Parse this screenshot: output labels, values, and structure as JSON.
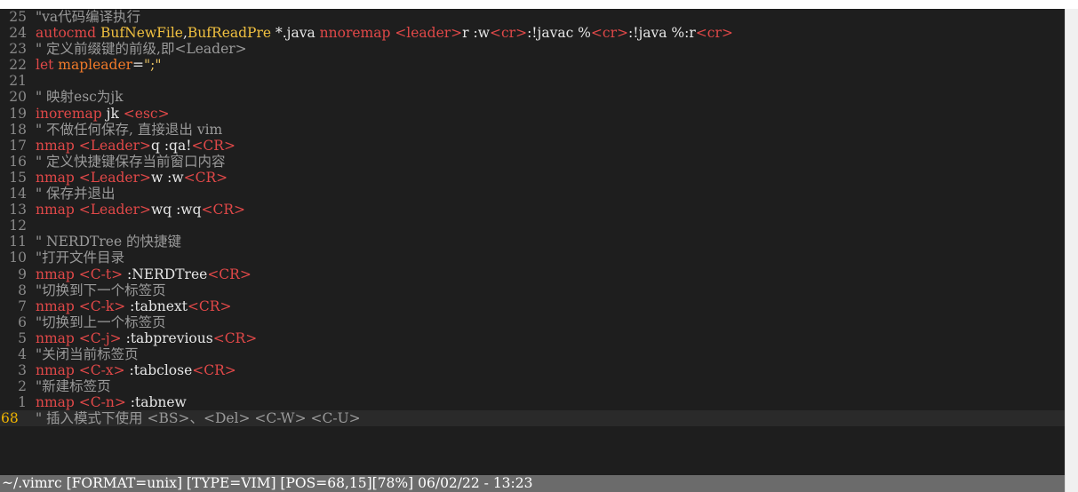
{
  "colors": {
    "background": "#1e1e1e",
    "line_number": "#8a8a8a",
    "current_line_number": "#f0b400",
    "comment": "#9a9a9a",
    "keyword": "#e04848",
    "statusbar_bg": "#6b6b6b"
  },
  "lines": [
    {
      "num": "25",
      "segs": [
        [
          "cm",
          "\"va代码编译执行"
        ]
      ]
    },
    {
      "num": "24",
      "segs": [
        [
          "kw",
          "autocmd "
        ],
        [
          "ev",
          "BufNewFile"
        ],
        [
          "tx",
          ","
        ],
        [
          "ev",
          "BufReadPre"
        ],
        [
          "tx",
          " *.java "
        ],
        [
          "kw",
          "nnoremap "
        ],
        [
          "tag",
          "<leader>"
        ],
        [
          "tx",
          "r :w"
        ],
        [
          "tag",
          "<cr>"
        ],
        [
          "tx",
          ":!javac %"
        ],
        [
          "tag",
          "<cr>"
        ],
        [
          "tx",
          ":!java %:r"
        ],
        [
          "tag",
          "<cr>"
        ]
      ]
    },
    {
      "num": "23",
      "segs": [
        [
          "cm",
          "\" 定义前缀键的前级,即<Leader>"
        ]
      ]
    },
    {
      "num": "22",
      "segs": [
        [
          "kw",
          "let "
        ],
        [
          "kw2",
          "mapleader"
        ],
        [
          "tx",
          "="
        ],
        [
          "str",
          "\";\""
        ]
      ]
    },
    {
      "num": "21",
      "segs": []
    },
    {
      "num": "20",
      "segs": [
        [
          "cm",
          "\" 映射esc为jk"
        ]
      ]
    },
    {
      "num": "19",
      "segs": [
        [
          "kw",
          "inoremap "
        ],
        [
          "tx",
          "jk "
        ],
        [
          "tag",
          "<esc>"
        ]
      ]
    },
    {
      "num": "18",
      "segs": [
        [
          "cm",
          "\" 不做任何保存, 直接退出 vim"
        ]
      ]
    },
    {
      "num": "17",
      "segs": [
        [
          "kw",
          "nmap "
        ],
        [
          "tag",
          "<Leader>"
        ],
        [
          "tx",
          "q :qa!"
        ],
        [
          "tag",
          "<CR>"
        ]
      ]
    },
    {
      "num": "16",
      "segs": [
        [
          "cm",
          "\" 定义快捷键保存当前窗口内容"
        ]
      ]
    },
    {
      "num": "15",
      "segs": [
        [
          "kw",
          "nmap "
        ],
        [
          "tag",
          "<Leader>"
        ],
        [
          "tx",
          "w :w"
        ],
        [
          "tag",
          "<CR>"
        ]
      ]
    },
    {
      "num": "14",
      "segs": [
        [
          "cm",
          "\" 保存并退出"
        ]
      ]
    },
    {
      "num": "13",
      "segs": [
        [
          "kw",
          "nmap "
        ],
        [
          "tag",
          "<Leader>"
        ],
        [
          "tx",
          "wq :wq"
        ],
        [
          "tag",
          "<CR>"
        ]
      ]
    },
    {
      "num": "12",
      "segs": []
    },
    {
      "num": "11",
      "segs": [
        [
          "cm",
          "\" NERDTree 的快捷键"
        ]
      ]
    },
    {
      "num": "10",
      "segs": [
        [
          "cm",
          "\"打开文件目录"
        ]
      ]
    },
    {
      "num": "9",
      "segs": [
        [
          "kw",
          "nmap "
        ],
        [
          "tag",
          "<C-t>"
        ],
        [
          "tx",
          " :NERDTree"
        ],
        [
          "tag",
          "<CR>"
        ]
      ]
    },
    {
      "num": "8",
      "segs": [
        [
          "cm",
          "\"切换到下一个标签页"
        ]
      ]
    },
    {
      "num": "7",
      "segs": [
        [
          "kw",
          "nmap "
        ],
        [
          "tag",
          "<C-k>"
        ],
        [
          "tx",
          " :tabnext"
        ],
        [
          "tag",
          "<CR>"
        ]
      ]
    },
    {
      "num": "6",
      "segs": [
        [
          "cm",
          "\"切换到上一个标签页"
        ]
      ]
    },
    {
      "num": "5",
      "segs": [
        [
          "kw",
          "nmap "
        ],
        [
          "tag",
          "<C-j>"
        ],
        [
          "tx",
          " :tabprevious"
        ],
        [
          "tag",
          "<CR>"
        ]
      ]
    },
    {
      "num": "4",
      "segs": [
        [
          "cm",
          "\"关闭当前标签页"
        ]
      ]
    },
    {
      "num": "3",
      "segs": [
        [
          "kw",
          "nmap "
        ],
        [
          "tag",
          "<C-x>"
        ],
        [
          "tx",
          " :tabclose"
        ],
        [
          "tag",
          "<CR>"
        ]
      ]
    },
    {
      "num": "2",
      "segs": [
        [
          "cm",
          "\"新建标签页"
        ]
      ]
    },
    {
      "num": "1",
      "segs": [
        [
          "kw",
          "nmap "
        ],
        [
          "tag",
          "<C-n>"
        ],
        [
          "tx",
          " :tabnew"
        ]
      ]
    },
    {
      "num": "68",
      "current": true,
      "segs": [
        [
          "cm",
          "\" 插入模式下使用 <BS>、<Del> <C-W> <C-U>"
        ]
      ]
    }
  ],
  "statusbar": {
    "text": "~/.vimrc [FORMAT=unix] [TYPE=VIM] [POS=68,15][78%] 06/02/22 - 13:23"
  }
}
